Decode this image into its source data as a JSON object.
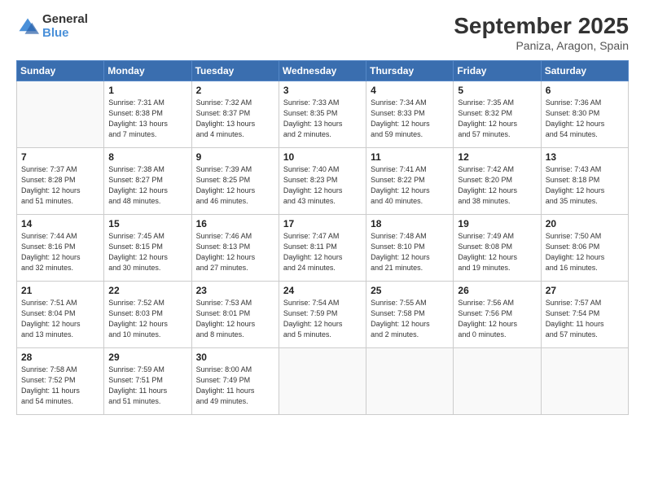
{
  "logo": {
    "line1": "General",
    "line2": "Blue"
  },
  "header": {
    "month": "September 2025",
    "location": "Paniza, Aragon, Spain"
  },
  "weekdays": [
    "Sunday",
    "Monday",
    "Tuesday",
    "Wednesday",
    "Thursday",
    "Friday",
    "Saturday"
  ],
  "weeks": [
    [
      {
        "day": "",
        "info": ""
      },
      {
        "day": "1",
        "info": "Sunrise: 7:31 AM\nSunset: 8:38 PM\nDaylight: 13 hours\nand 7 minutes."
      },
      {
        "day": "2",
        "info": "Sunrise: 7:32 AM\nSunset: 8:37 PM\nDaylight: 13 hours\nand 4 minutes."
      },
      {
        "day": "3",
        "info": "Sunrise: 7:33 AM\nSunset: 8:35 PM\nDaylight: 13 hours\nand 2 minutes."
      },
      {
        "day": "4",
        "info": "Sunrise: 7:34 AM\nSunset: 8:33 PM\nDaylight: 12 hours\nand 59 minutes."
      },
      {
        "day": "5",
        "info": "Sunrise: 7:35 AM\nSunset: 8:32 PM\nDaylight: 12 hours\nand 57 minutes."
      },
      {
        "day": "6",
        "info": "Sunrise: 7:36 AM\nSunset: 8:30 PM\nDaylight: 12 hours\nand 54 minutes."
      }
    ],
    [
      {
        "day": "7",
        "info": "Sunrise: 7:37 AM\nSunset: 8:28 PM\nDaylight: 12 hours\nand 51 minutes."
      },
      {
        "day": "8",
        "info": "Sunrise: 7:38 AM\nSunset: 8:27 PM\nDaylight: 12 hours\nand 48 minutes."
      },
      {
        "day": "9",
        "info": "Sunrise: 7:39 AM\nSunset: 8:25 PM\nDaylight: 12 hours\nand 46 minutes."
      },
      {
        "day": "10",
        "info": "Sunrise: 7:40 AM\nSunset: 8:23 PM\nDaylight: 12 hours\nand 43 minutes."
      },
      {
        "day": "11",
        "info": "Sunrise: 7:41 AM\nSunset: 8:22 PM\nDaylight: 12 hours\nand 40 minutes."
      },
      {
        "day": "12",
        "info": "Sunrise: 7:42 AM\nSunset: 8:20 PM\nDaylight: 12 hours\nand 38 minutes."
      },
      {
        "day": "13",
        "info": "Sunrise: 7:43 AM\nSunset: 8:18 PM\nDaylight: 12 hours\nand 35 minutes."
      }
    ],
    [
      {
        "day": "14",
        "info": "Sunrise: 7:44 AM\nSunset: 8:16 PM\nDaylight: 12 hours\nand 32 minutes."
      },
      {
        "day": "15",
        "info": "Sunrise: 7:45 AM\nSunset: 8:15 PM\nDaylight: 12 hours\nand 30 minutes."
      },
      {
        "day": "16",
        "info": "Sunrise: 7:46 AM\nSunset: 8:13 PM\nDaylight: 12 hours\nand 27 minutes."
      },
      {
        "day": "17",
        "info": "Sunrise: 7:47 AM\nSunset: 8:11 PM\nDaylight: 12 hours\nand 24 minutes."
      },
      {
        "day": "18",
        "info": "Sunrise: 7:48 AM\nSunset: 8:10 PM\nDaylight: 12 hours\nand 21 minutes."
      },
      {
        "day": "19",
        "info": "Sunrise: 7:49 AM\nSunset: 8:08 PM\nDaylight: 12 hours\nand 19 minutes."
      },
      {
        "day": "20",
        "info": "Sunrise: 7:50 AM\nSunset: 8:06 PM\nDaylight: 12 hours\nand 16 minutes."
      }
    ],
    [
      {
        "day": "21",
        "info": "Sunrise: 7:51 AM\nSunset: 8:04 PM\nDaylight: 12 hours\nand 13 minutes."
      },
      {
        "day": "22",
        "info": "Sunrise: 7:52 AM\nSunset: 8:03 PM\nDaylight: 12 hours\nand 10 minutes."
      },
      {
        "day": "23",
        "info": "Sunrise: 7:53 AM\nSunset: 8:01 PM\nDaylight: 12 hours\nand 8 minutes."
      },
      {
        "day": "24",
        "info": "Sunrise: 7:54 AM\nSunset: 7:59 PM\nDaylight: 12 hours\nand 5 minutes."
      },
      {
        "day": "25",
        "info": "Sunrise: 7:55 AM\nSunset: 7:58 PM\nDaylight: 12 hours\nand 2 minutes."
      },
      {
        "day": "26",
        "info": "Sunrise: 7:56 AM\nSunset: 7:56 PM\nDaylight: 12 hours\nand 0 minutes."
      },
      {
        "day": "27",
        "info": "Sunrise: 7:57 AM\nSunset: 7:54 PM\nDaylight: 11 hours\nand 57 minutes."
      }
    ],
    [
      {
        "day": "28",
        "info": "Sunrise: 7:58 AM\nSunset: 7:52 PM\nDaylight: 11 hours\nand 54 minutes."
      },
      {
        "day": "29",
        "info": "Sunrise: 7:59 AM\nSunset: 7:51 PM\nDaylight: 11 hours\nand 51 minutes."
      },
      {
        "day": "30",
        "info": "Sunrise: 8:00 AM\nSunset: 7:49 PM\nDaylight: 11 hours\nand 49 minutes."
      },
      {
        "day": "",
        "info": ""
      },
      {
        "day": "",
        "info": ""
      },
      {
        "day": "",
        "info": ""
      },
      {
        "day": "",
        "info": ""
      }
    ]
  ]
}
